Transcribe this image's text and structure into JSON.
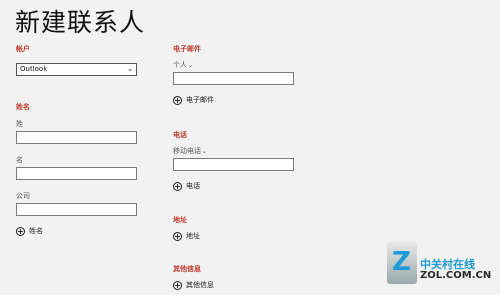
{
  "page": {
    "title": "新建联系人"
  },
  "account": {
    "label": "帐户",
    "selected": "Outlook"
  },
  "name_section": {
    "label": "姓名",
    "surname_label": "姓",
    "given_name_label": "名",
    "company_label": "公司",
    "add_label": "姓名"
  },
  "email_section": {
    "label": "电子邮件",
    "type_label": "个人",
    "add_label": "电子邮件"
  },
  "phone_section": {
    "label": "电话",
    "type_label": "移动电话",
    "add_label": "电话"
  },
  "address_section": {
    "label": "地址",
    "add_label": "地址"
  },
  "other_section": {
    "label": "其他信息",
    "add_label": "其他信息"
  },
  "watermark": {
    "badge_letter": "Z",
    "cn": "中关村在线",
    "url": "ZOL.COM.CN"
  },
  "icons": {
    "plus": "+",
    "chevron": "⌄",
    "select_arrow": "⌄"
  }
}
